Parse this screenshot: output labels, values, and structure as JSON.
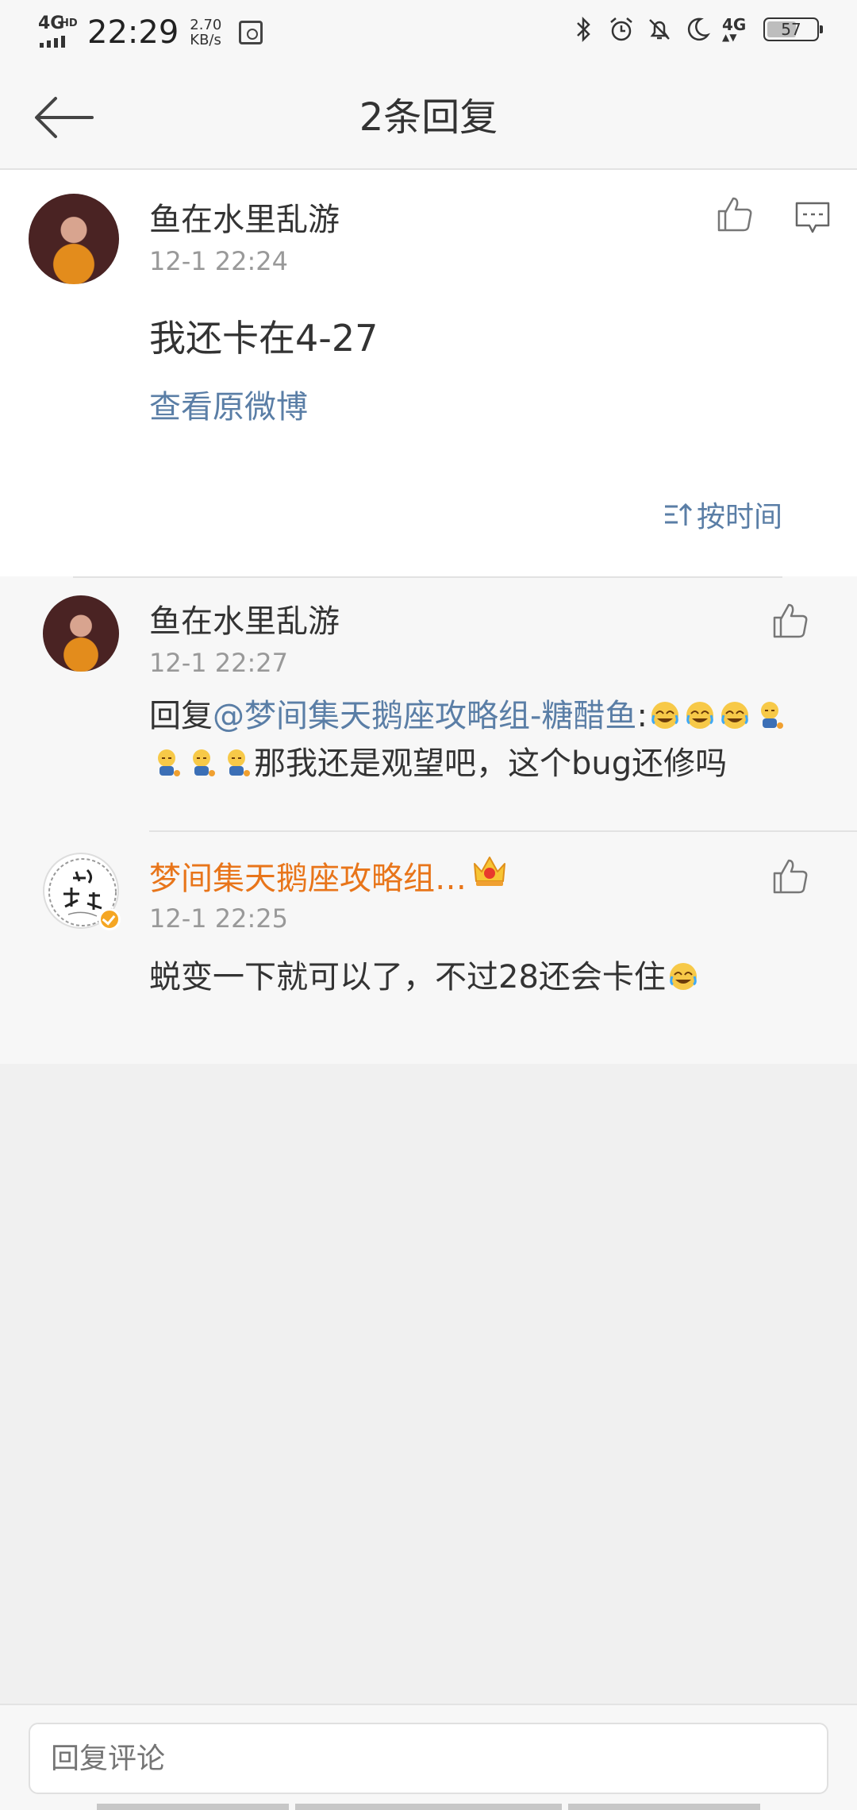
{
  "status_bar": {
    "network": "4G",
    "network_hd": "HD",
    "time": "22:29",
    "speed_value": "2.70",
    "speed_unit": "KB/s",
    "network_right": "4G",
    "battery": "57"
  },
  "header": {
    "title": "2条回复"
  },
  "main_comment": {
    "author": "鱼在水里乱游",
    "time": "12-1 22:24",
    "text": "我还卡在4-27",
    "view_original": "查看原微博",
    "sort_label": "按时间"
  },
  "replies": [
    {
      "author": "鱼在水里乱游",
      "time": "12-1 22:27",
      "prefix": "回复",
      "mention": "@梦间集天鹅座攻略组-糖醋鱼",
      "colon": ":",
      "text": "那我还是观望吧，这个bug还修吗"
    },
    {
      "author": "梦间集天鹅座攻略组…",
      "time": "12-1 22:25",
      "text": "蜕变一下就可以了，不过28还会卡住"
    }
  ],
  "bottom": {
    "input_placeholder": "回复评论"
  },
  "colors": {
    "link": "#5a7ea6",
    "vip_name": "#e8751a",
    "verified_badge": "#f5a623"
  }
}
